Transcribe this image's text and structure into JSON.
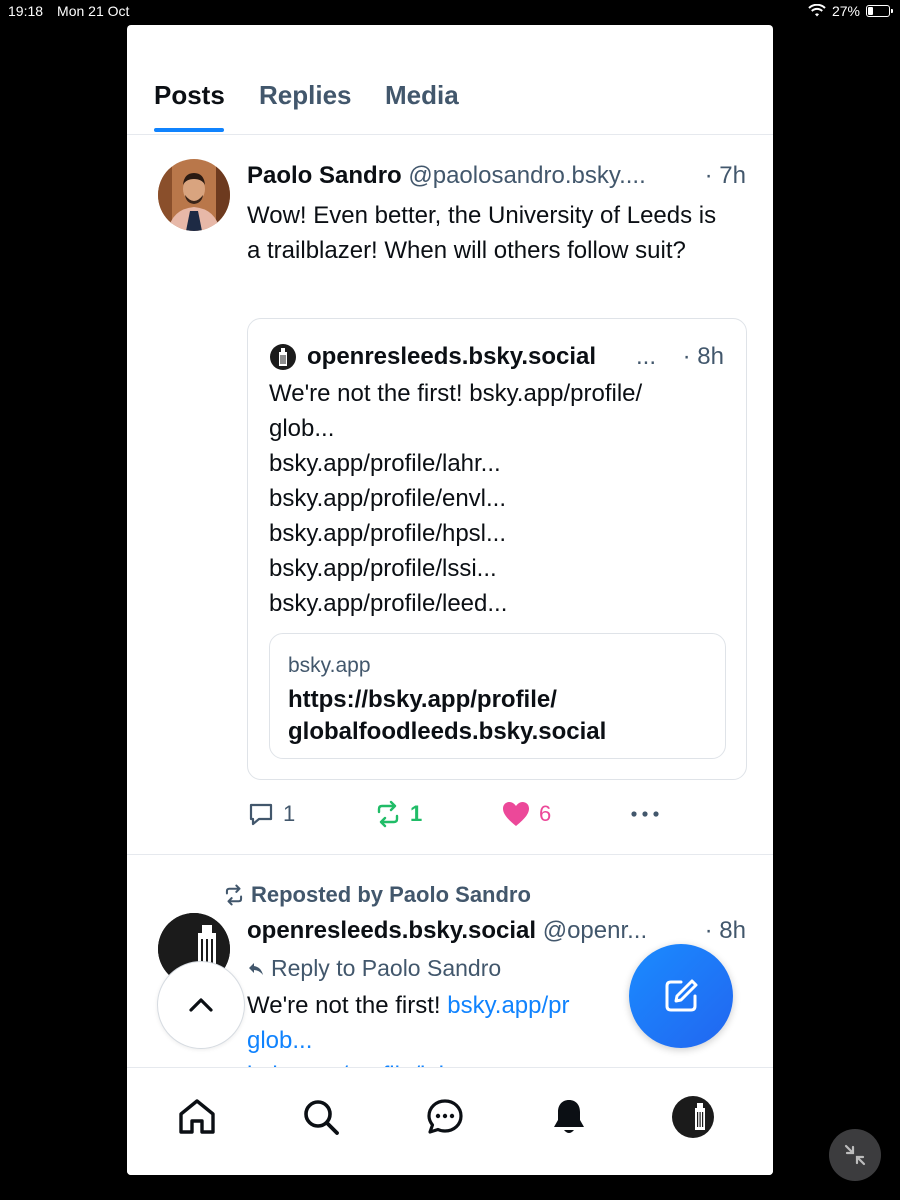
{
  "status_bar": {
    "time": "19:18",
    "date": "Mon 21 Oct",
    "battery": "27%",
    "battery_level": 0.27
  },
  "tabs": [
    {
      "label": "Posts",
      "active": true
    },
    {
      "label": "Replies",
      "active": false
    },
    {
      "label": "Media",
      "active": false
    }
  ],
  "post1": {
    "author": "Paolo Sandro",
    "handle": "@paolosandro.bsky....",
    "time": "· 7h",
    "text": "Wow! Even better, the University of Leeds is a trailblazer! When will others follow suit?",
    "quote": {
      "handle": "openresleeds.bsky.social",
      "ellipsis": "...",
      "time": "· 8h",
      "lines": [
        "We're not the first! bsky.app/profile/",
        "glob...",
        "bsky.app/profile/lahr...",
        "bsky.app/profile/envl...",
        "bsky.app/profile/hpsl...",
        "bsky.app/profile/lssi...",
        "bsky.app/profile/leed..."
      ],
      "link_card": {
        "domain": "bsky.app",
        "title": "https://bsky.app/profile/ globalfoodleeds.bsky.social"
      }
    },
    "actions": {
      "replies": "1",
      "reposts": "1",
      "likes": "6"
    }
  },
  "post2": {
    "reposted_by": "Reposted by Paolo Sandro",
    "author": "openresleeds.bsky.social",
    "handle": "@openr...",
    "time": "· 8h",
    "reply_to": "Reply to Paolo Sandro",
    "text_prefix": "We're not the first! ",
    "text_link": "bsky.app/pr",
    "text_line2": "glob...",
    "text_line3": "bsky.app/profile/lahr..."
  },
  "colors": {
    "accent": "#1083fe",
    "repost": "#20bc67",
    "like": "#ec4899",
    "muted": "#42576c"
  },
  "icons": {
    "nav": [
      "home-icon",
      "search-icon",
      "chat-icon",
      "bell-icon",
      "profile-avatar"
    ],
    "fab": "compose-icon",
    "scroll": "chevron-up-icon"
  }
}
